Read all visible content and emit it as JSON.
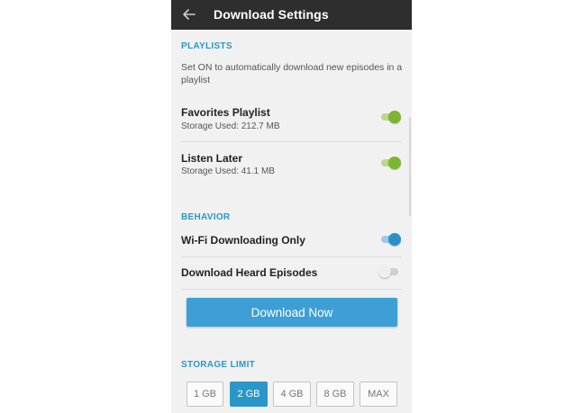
{
  "appbar": {
    "title": "Download Settings",
    "back_icon": "arrow-left-icon"
  },
  "playlists": {
    "header": "PLAYLISTS",
    "description": "Set ON to automatically download new episodes in a playlist",
    "items": [
      {
        "name": "Favorites Playlist",
        "storage": "Storage Used: 212.7 MB",
        "enabled": true
      },
      {
        "name": "Listen Later",
        "storage": "Storage Used: 41.1 MB",
        "enabled": true
      }
    ]
  },
  "behavior": {
    "header": "BEHAVIOR",
    "items": [
      {
        "name": "Wi-Fi Downloading Only",
        "enabled": true
      },
      {
        "name": "Download Heard Episodes",
        "enabled": false
      }
    ]
  },
  "download_now": {
    "label": "Download Now"
  },
  "storage_limit": {
    "header": "STORAGE LIMIT",
    "options": [
      "1 GB",
      "2 GB",
      "4 GB",
      "8 GB",
      "MAX"
    ],
    "selected": "2 GB"
  },
  "colors": {
    "accent": "#2a97c9",
    "toggle_green": "#7cb52f",
    "toggle_blue": "#2a90cc",
    "appbar": "#2e2e2e"
  }
}
